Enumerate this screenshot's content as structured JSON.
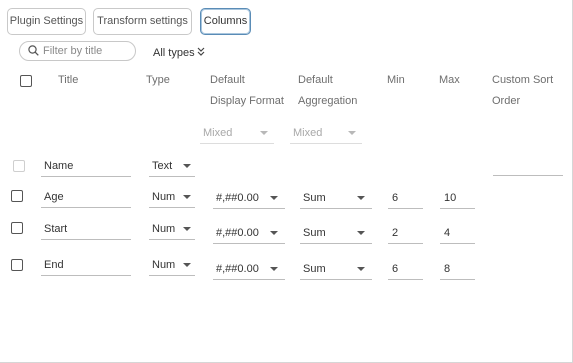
{
  "tabs": [
    {
      "label": "Plugin Settings",
      "active": false
    },
    {
      "label": "Transform settings",
      "active": false
    },
    {
      "label": "Columns",
      "active": true
    }
  ],
  "filter": {
    "placeholder": "Filter by title",
    "icon": "search-icon"
  },
  "type_filter": {
    "label": "All types",
    "icon": "double-chevron-down-icon"
  },
  "headers": {
    "title": "Title",
    "type": "Type",
    "format_line1": "Default",
    "format_line2": "Display Format",
    "aggregation_line1": "Default",
    "aggregation_line2": "Aggregation",
    "min": "Min",
    "max": "Max",
    "sort_line1": "Custom Sort",
    "sort_line2": "Order"
  },
  "bulk": {
    "format": "Mixed",
    "aggregation": "Mixed"
  },
  "rows": [
    {
      "title": "Name",
      "type": "Text",
      "format": "",
      "aggregation": "",
      "min": "",
      "max": "",
      "checkbox_disabled": true
    },
    {
      "title": "Age",
      "type": "Num",
      "format": "#,##0.00",
      "aggregation": "Sum",
      "min": "6",
      "max": "10",
      "checkbox_disabled": false
    },
    {
      "title": "Start",
      "type": "Num",
      "format": "#,##0.00",
      "aggregation": "Sum",
      "min": "2",
      "max": "4",
      "checkbox_disabled": false
    },
    {
      "title": "End",
      "type": "Num",
      "format": "#,##0.00",
      "aggregation": "Sum",
      "min": "6",
      "max": "8",
      "checkbox_disabled": false
    }
  ],
  "colors": {
    "accent": "#5a8cb6",
    "border": "#c9c9c9",
    "text": "#333333",
    "muted": "#6e6e6e"
  }
}
